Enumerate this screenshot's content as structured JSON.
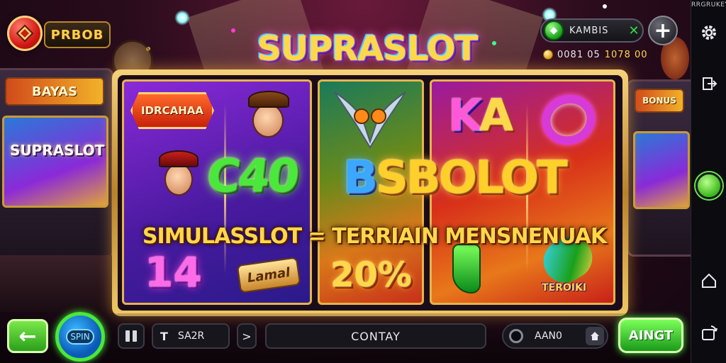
{
  "header": {
    "logo_text": "PRBOB",
    "title": "SUPRASLOT",
    "coin_pill_value": "KAMBIS",
    "coin_pill_close": "✕",
    "add_label": "+",
    "balance_a": "0081 05",
    "balance_b": "1078 00"
  },
  "arcade_left": {
    "marquee": "BAYAS",
    "title": "SUPRASLOT"
  },
  "arcade_right": {
    "marquee": "BONUS"
  },
  "reels": {
    "tag": "IDRCAHAA",
    "word_green": "C40",
    "word_blue_letter": "B",
    "word_gold": "SBOLOT",
    "banner": "SIMULASSLOT = TERRIAIN MENSNENUAK",
    "num_left": "14",
    "lamal": "Lamal",
    "pct": "20%",
    "ka_k": "K",
    "ka_a": "A",
    "teroiki": "TEROIKI"
  },
  "bottom": {
    "back_label": "←",
    "spin_label": "SPIN",
    "bet_icon": "T",
    "bet_value": "SA2R",
    "next_label": ">",
    "contay_label": "CONTAY",
    "auto_value": "AAN0",
    "go_label": "AINGT"
  },
  "rail": {
    "label": "RRGRUKEY"
  },
  "colors": {
    "accent_green": "#4ae83a",
    "accent_gold": "#ffd84a",
    "accent_blue": "#3aa8ff",
    "accent_pink": "#ff58d8"
  },
  "icons": [
    "gem-icon",
    "gear-icon",
    "exit-icon",
    "home-icon",
    "rotate-icon",
    "back-arrow-icon",
    "spin-icon",
    "pause-icon",
    "home-small-icon"
  ]
}
